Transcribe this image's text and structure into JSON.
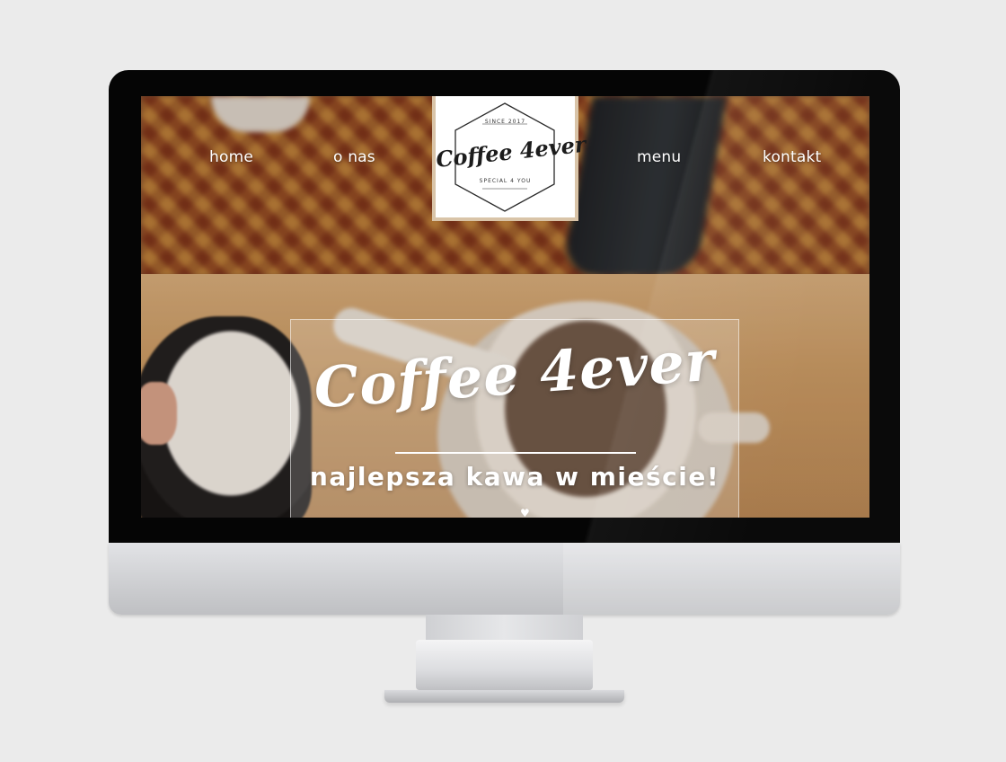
{
  "nav": {
    "items": [
      {
        "label": "home"
      },
      {
        "label": "o nas"
      },
      {
        "label": "menu"
      },
      {
        "label": "kontakt"
      }
    ]
  },
  "logo": {
    "since": "SINCE 2017",
    "name": "Coffee 4ever",
    "tagline": "SPECIAL 4 YOU"
  },
  "hero": {
    "title": "Coffee 4ever",
    "subtitle": "najlepsza kawa w mieście!",
    "scroll_icon": "heart-icon"
  },
  "colors": {
    "monitor_bezel": "#050505",
    "monitor_chin": "#c9cacd",
    "logo_border": "#d9c4a8",
    "text": "#ffffff",
    "page_background": "#ebebeb"
  }
}
